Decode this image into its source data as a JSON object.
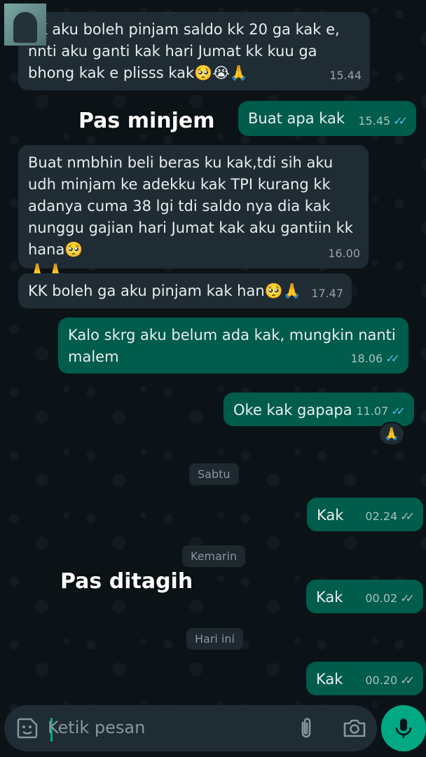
{
  "messages": [
    {
      "text": "KK aku boleh pinjam saldo kk 20 ga kak e, nnti aku ganti kak hari Jumat kk kuu ga bhong kak e plisss kak🥺😭🙏",
      "time": "15.44",
      "dir": "in"
    },
    {
      "text": "Buat apa kak",
      "time": "15.45",
      "dir": "out",
      "status": "read"
    },
    {
      "text": "Buat nmbhin beli beras ku kak,tdi sih aku udh minjam ke adekku kak TPI kurang kk adanya cuma 38 lgi tdi saldo nya dia kak nunggu gajian hari Jumat kak aku gantiin kk hana🥺\n🙏🙏",
      "time": "16.00",
      "dir": "in"
    },
    {
      "text": "KK boleh ga aku pinjam kak han🥺🙏",
      "time": "17.47",
      "dir": "in"
    },
    {
      "text": "Kalo skrg aku belum ada kak, mungkin nanti malem",
      "time": "18.06",
      "dir": "out",
      "status": "read"
    },
    {
      "text": "Oke kak gapapa",
      "time": "11.07",
      "dir": "out",
      "status": "read",
      "reaction": "🙏"
    },
    {
      "text": "Kak",
      "time": "02.24",
      "dir": "out",
      "status": "delivered"
    },
    {
      "text": "Kak",
      "time": "00.02",
      "dir": "out",
      "status": "delivered"
    },
    {
      "text": "Kak",
      "time": "00.20",
      "dir": "out",
      "status": "delivered"
    }
  ],
  "date_separators": [
    "Sabtu",
    "Kemarin",
    "Hari ini"
  ],
  "annotations": [
    "Pas minjem",
    "Pas ditagih"
  ],
  "composer": {
    "placeholder": "Ketik pesan"
  },
  "icons": {
    "emoji": "sticker-icon",
    "attach": "paperclip-icon",
    "camera": "camera-icon",
    "mic": "microphone-icon",
    "read_ticks": "double-check-blue-icon",
    "delivered_ticks": "double-check-grey-icon"
  },
  "colors": {
    "incoming_bubble": "#1f2c33",
    "outgoing_bubble": "#005c4b",
    "accent": "#00a884",
    "read_tick": "#53bdeb"
  }
}
